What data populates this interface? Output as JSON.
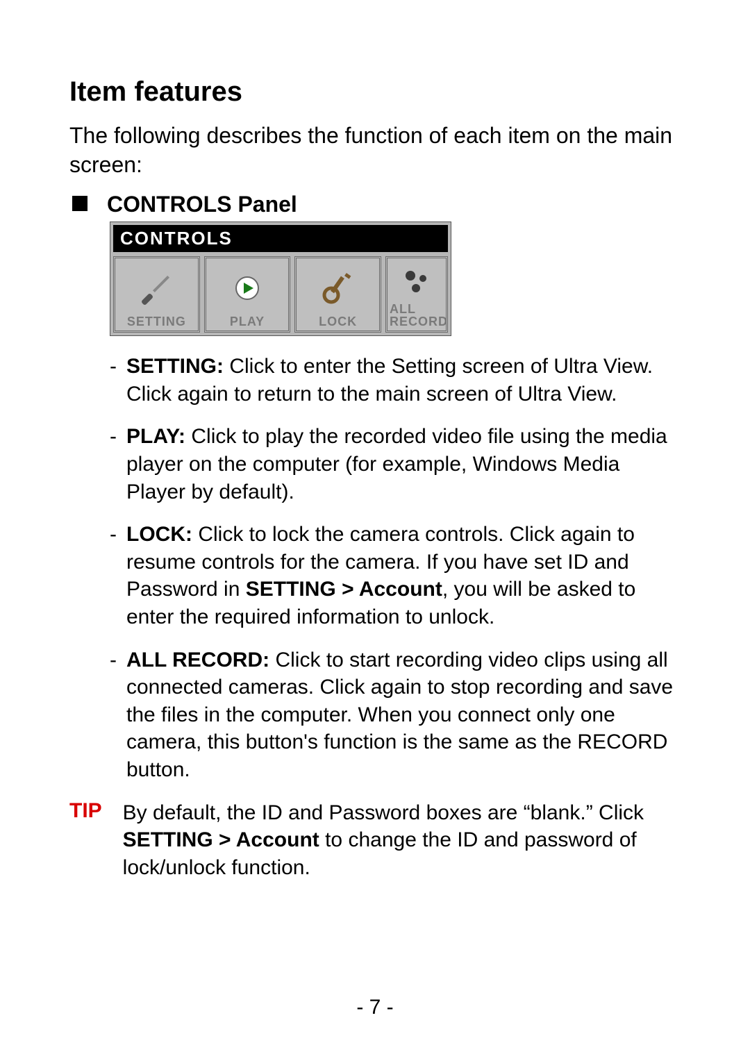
{
  "heading": "Item features",
  "intro": "The following describes the function of each item on the main screen:",
  "bullet_label": "CONTROLS Panel",
  "controls_graphic": {
    "title": "CONTROLS",
    "items": [
      {
        "label": "SETTING",
        "icon": "screwdriver-icon"
      },
      {
        "label": "PLAY",
        "icon": "play-icon"
      },
      {
        "label": "LOCK",
        "icon": "key-icon"
      },
      {
        "label": "ALL\nRECORD",
        "icon": "record-dots-icon"
      }
    ]
  },
  "descriptions": [
    {
      "term": "SETTING:",
      "text": " Click to enter the Setting screen of Ultra View. Click again to return to the main screen of Ultra View."
    },
    {
      "term": "PLAY:",
      "text": " Click to play the recorded video file using the media player on the computer (for example, Windows Media Player by default)."
    },
    {
      "term": "LOCK:",
      "text_pre": " Click to lock the camera controls. Click again to resume controls for the camera. If you have set ID and Password in ",
      "bold_mid": "SETTING > Account",
      "text_post": ", you will be asked to enter the required information to unlock."
    },
    {
      "term": "ALL RECORD:",
      "text": " Click to start recording video clips using all connected cameras. Click again to stop recording and save the files in the computer. When you connect only one camera, this button's function is the same as the RECORD button."
    }
  ],
  "tip": {
    "label": "TIP",
    "pre": "By default, the ID and Password boxes are “blank.” Click ",
    "bold": "SETTING > Account",
    "post": " to change the ID and password of lock/unlock function."
  },
  "page_number": "- 7 -"
}
